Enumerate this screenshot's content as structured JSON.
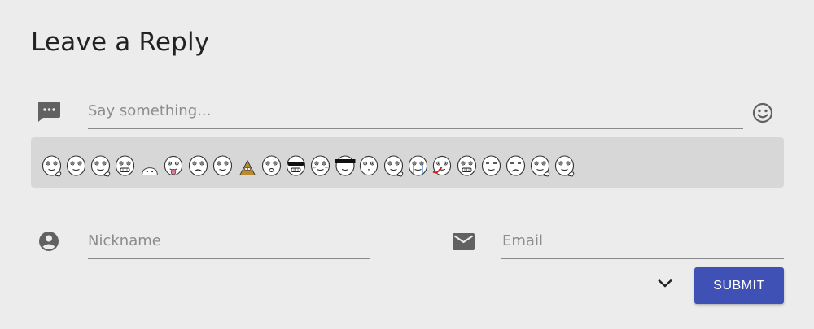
{
  "heading": "Leave a Reply",
  "comment": {
    "placeholder": "Say something...",
    "value": "",
    "icon": "comment-icon"
  },
  "emoji_button": {
    "icon": "emoji-smile-icon"
  },
  "emoji_panel": {
    "items": [
      {
        "name": "emoji-thumbs-up"
      },
      {
        "name": "emoji-smirk"
      },
      {
        "name": "emoji-peace"
      },
      {
        "name": "emoji-grin"
      },
      {
        "name": "emoji-peek"
      },
      {
        "name": "emoji-tongue"
      },
      {
        "name": "emoji-sad"
      },
      {
        "name": "emoji-smile"
      },
      {
        "name": "emoji-pyramid"
      },
      {
        "name": "emoji-surprised"
      },
      {
        "name": "emoji-sunglasses"
      },
      {
        "name": "emoji-blush"
      },
      {
        "name": "emoji-censored"
      },
      {
        "name": "emoji-dots"
      },
      {
        "name": "emoji-shrug"
      },
      {
        "name": "emoji-crying"
      },
      {
        "name": "emoji-nosebleed"
      },
      {
        "name": "emoji-teeth"
      },
      {
        "name": "emoji-meh"
      },
      {
        "name": "emoji-worried"
      },
      {
        "name": "emoji-facepalm"
      },
      {
        "name": "emoji-pondering"
      }
    ]
  },
  "nickname": {
    "placeholder": "Nickname",
    "value": "",
    "icon": "account-circle-icon"
  },
  "email": {
    "placeholder": "Email",
    "value": "",
    "icon": "mail-icon"
  },
  "expand": {
    "icon": "chevron-down-icon"
  },
  "submit": {
    "label": "SUBMIT"
  },
  "colors": {
    "background": "#ececec",
    "panel": "#d7d7d7",
    "accent": "#3f51b5",
    "icon": "#616161",
    "placeholder": "#8c8c8c"
  }
}
